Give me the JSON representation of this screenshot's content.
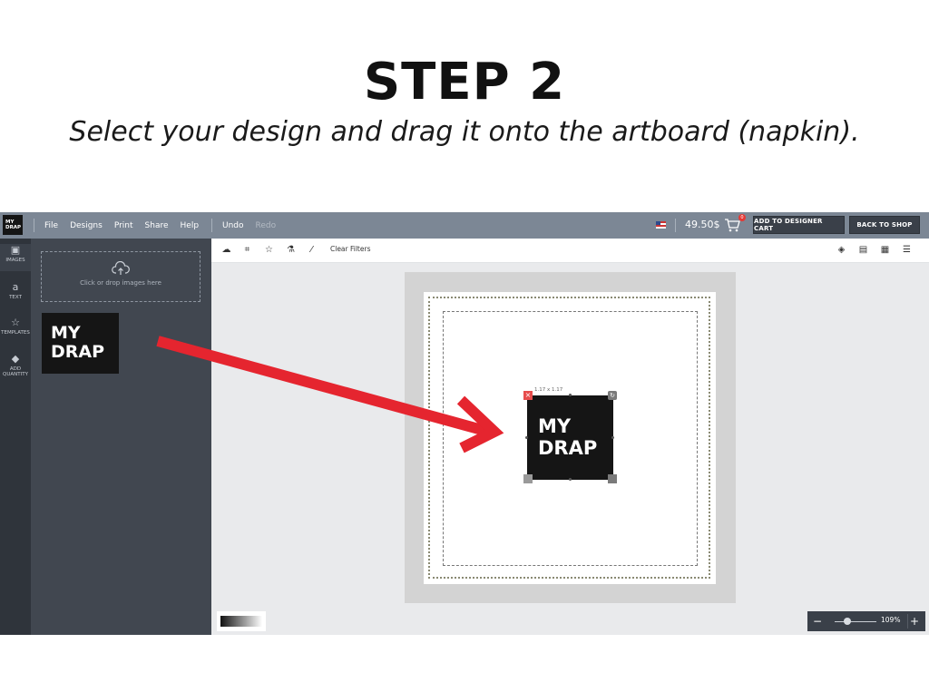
{
  "header": {
    "title": "STEP 2",
    "subtitle": "Select your design and drag it onto the artboard (napkin)."
  },
  "app": {
    "logo": {
      "line1": "MY",
      "line2": "DRAP"
    },
    "menu": [
      "File",
      "Designs",
      "Print",
      "Share",
      "Help"
    ],
    "undo": "Undo",
    "redo": "Redo",
    "price": "49.50$",
    "cart_count": "0",
    "add_to_cart": "ADD TO DESIGNER CART",
    "back_to_shop": "BACK TO SHOP",
    "sidebar": [
      {
        "label": "IMAGES",
        "icon": "image-icon"
      },
      {
        "label": "TEXT",
        "icon": "text-icon"
      },
      {
        "label": "TEMPLATES",
        "icon": "star-icon"
      },
      {
        "label": "ADD QUANTITY",
        "icon": "box-icon"
      }
    ],
    "upload_text": "Click or drop images here",
    "thumbnail": {
      "line1": "MY",
      "line2": "DRAP"
    },
    "toolbar": {
      "clear_filters": "Clear Filters"
    },
    "design": {
      "size_label": "1.17 x 1.17",
      "line1": "MY",
      "line2": "DRAP"
    },
    "zoom": {
      "minus": "−",
      "level": "109%",
      "plus": "+"
    }
  },
  "colors": {
    "topbar": "#7c8795",
    "panel": "#414750",
    "arrow": "#e5252f"
  }
}
